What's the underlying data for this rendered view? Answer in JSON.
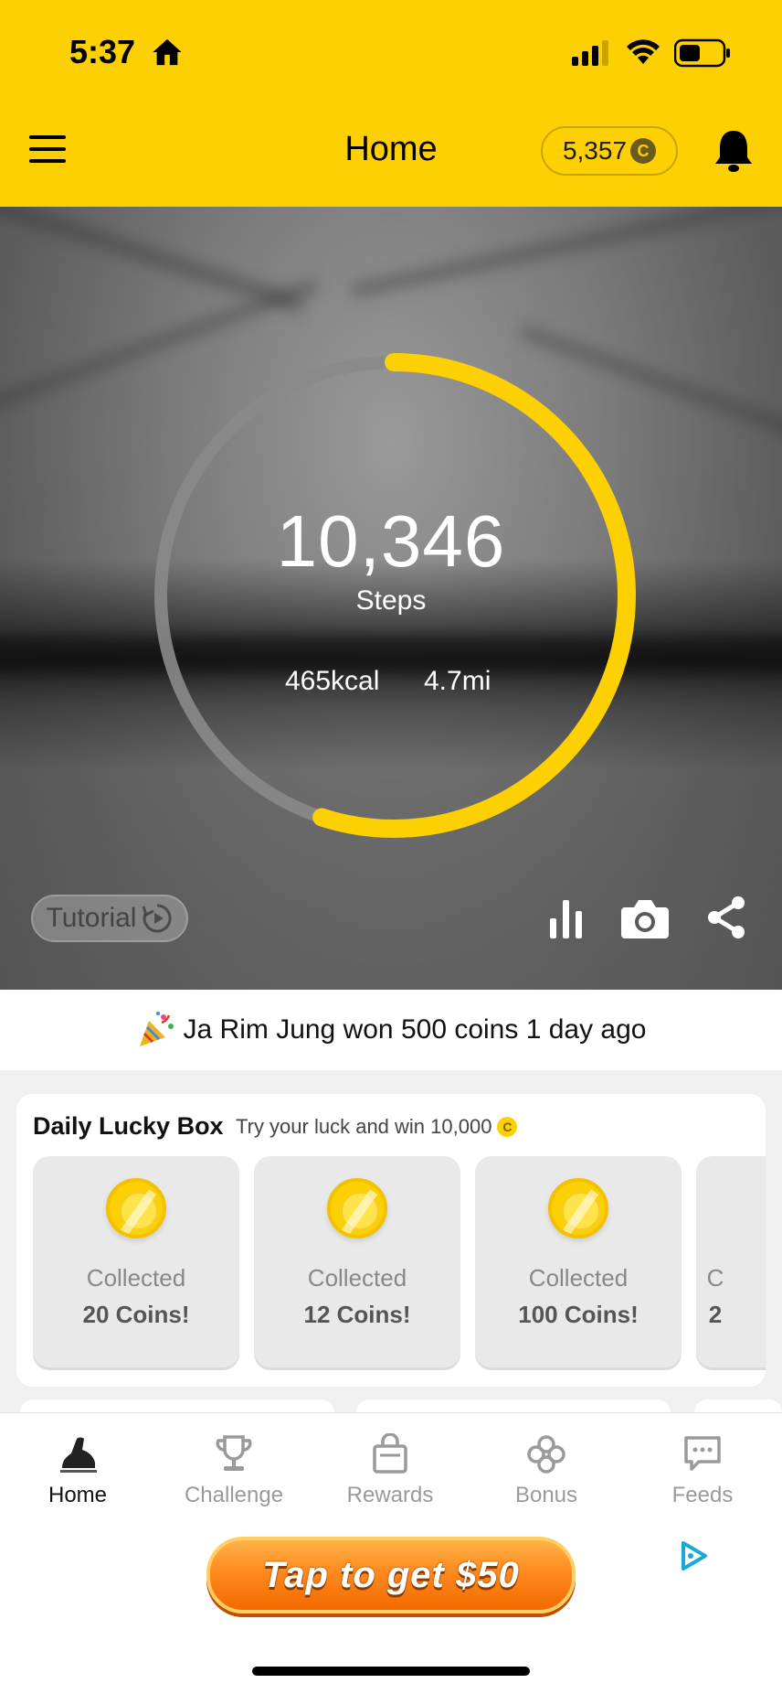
{
  "status_bar": {
    "time": "5:37"
  },
  "header": {
    "title": "Home",
    "coins": "5,357",
    "coin_symbol": "C"
  },
  "hero": {
    "steps": "10,346",
    "steps_label": "Steps",
    "kcal": "465kcal",
    "distance": "4.7mi",
    "progress_fraction": 0.55,
    "tutorial_label": "Tutorial"
  },
  "winner_banner": {
    "text": "Ja Rim Jung won 500 coins 1 day ago"
  },
  "lucky_box": {
    "title": "Daily Lucky Box",
    "subtitle": "Try your luck and win 10,000",
    "coin_symbol": "C",
    "boxes": [
      {
        "label": "Collected",
        "value": "20 Coins!"
      },
      {
        "label": "Collected",
        "value": "12 Coins!"
      },
      {
        "label": "Collected",
        "value": "100 Coins!"
      },
      {
        "label": "C",
        "value": "2"
      }
    ]
  },
  "nav": {
    "items": [
      {
        "label": "Home",
        "icon": "shoe-icon"
      },
      {
        "label": "Challenge",
        "icon": "trophy-icon"
      },
      {
        "label": "Rewards",
        "icon": "shopping-bag-icon"
      },
      {
        "label": "Bonus",
        "icon": "clover-icon"
      },
      {
        "label": "Feeds",
        "icon": "chat-icon"
      }
    ]
  },
  "ad": {
    "button_label": "Tap to get $50"
  },
  "colors": {
    "brand_yellow": "#FDD003",
    "ad_orange": "#F26A00",
    "ring_track": "#8A8A8A"
  }
}
